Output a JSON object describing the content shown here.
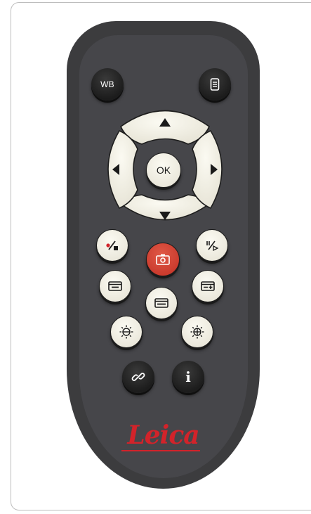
{
  "remote": {
    "brand_text": "Leica",
    "colors": {
      "body": "#3c3c3e",
      "inner": "#46464a",
      "dark_button": "#1c1c1c",
      "cream_button": "#f3f1e6",
      "capture_button": "#d0402f",
      "brand": "#d2232a"
    },
    "buttons": {
      "wb_label": "WB",
      "ok_label": "OK",
      "info_label": "i"
    },
    "icons": {
      "menu": "menu-list-icon",
      "up": "arrow-up-icon",
      "down": "arrow-down-icon",
      "left": "arrow-left-icon",
      "right": "arrow-right-icon",
      "record": "record-icon",
      "playpause": "play-pause-icon",
      "capture": "camera-icon",
      "overlay_minus": "overlay-minus-icon",
      "overlay_plus": "overlay-plus-icon",
      "overlay": "overlay-icon",
      "brightness_down": "brightness-down-icon",
      "brightness_up": "brightness-up-icon",
      "link": "link-icon"
    }
  }
}
